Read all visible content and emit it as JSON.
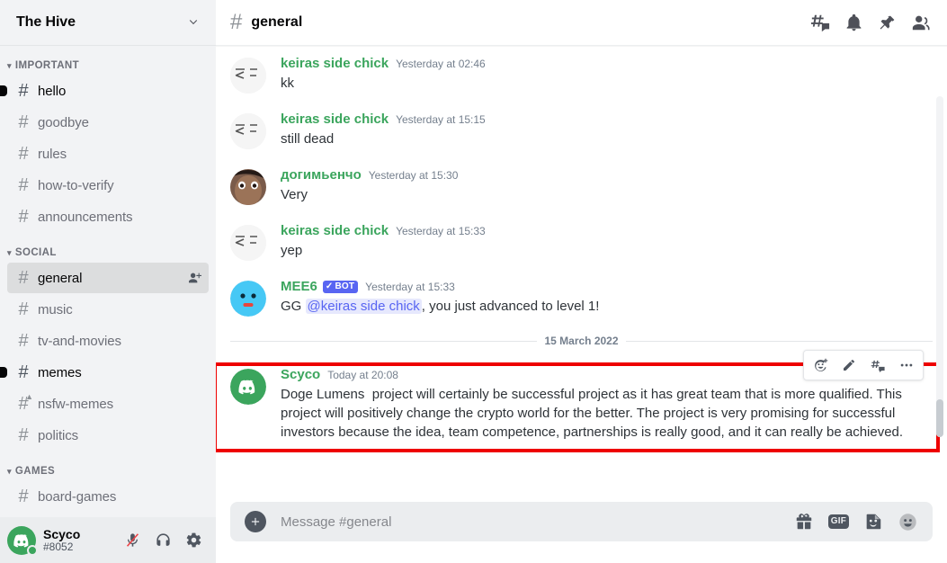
{
  "sidebar": {
    "server_name": "The Hive",
    "categories": [
      {
        "label": "IMPORTANT",
        "channels": [
          {
            "name": "hello",
            "state": "unread",
            "icon": "hash-icon"
          },
          {
            "name": "goodbye",
            "state": "normal",
            "icon": "hash-icon"
          },
          {
            "name": "rules",
            "state": "normal",
            "icon": "hash-icon"
          },
          {
            "name": "how-to-verify",
            "state": "normal",
            "icon": "hash-icon"
          },
          {
            "name": "announcements",
            "state": "normal",
            "icon": "hash-icon"
          }
        ]
      },
      {
        "label": "SOCIAL",
        "channels": [
          {
            "name": "general",
            "state": "active",
            "icon": "hash-icon",
            "action": "add-member-icon"
          },
          {
            "name": "music",
            "state": "normal",
            "icon": "hash-icon"
          },
          {
            "name": "tv-and-movies",
            "state": "normal",
            "icon": "hash-icon"
          },
          {
            "name": "memes",
            "state": "unread",
            "icon": "hash-icon"
          },
          {
            "name": "nsfw-memes",
            "state": "normal",
            "icon": "hash-nsfw-icon"
          },
          {
            "name": "politics",
            "state": "normal",
            "icon": "hash-icon"
          }
        ]
      },
      {
        "label": "GAMES",
        "channels": [
          {
            "name": "board-games",
            "state": "normal",
            "icon": "hash-icon"
          }
        ]
      }
    ],
    "user": {
      "name": "Scyco",
      "tag": "#8052",
      "status": "online",
      "avatar_color": "#3ba55d",
      "controls": [
        {
          "name": "mute-microphone-button",
          "icon": "microphone-muted-icon",
          "state": "muted"
        },
        {
          "name": "deafen-button",
          "icon": "headphones-icon",
          "state": "on"
        },
        {
          "name": "user-settings-button",
          "icon": "gear-icon",
          "state": "on"
        }
      ]
    }
  },
  "header": {
    "channel_icon": "hash-icon",
    "channel_name": "general",
    "icons": [
      {
        "name": "threads-button",
        "icon": "threads-icon"
      },
      {
        "name": "notification-settings-button",
        "icon": "bell-icon"
      },
      {
        "name": "pinned-messages-button",
        "icon": "pin-icon"
      },
      {
        "name": "member-list-button",
        "icon": "members-icon"
      }
    ]
  },
  "messages": [
    {
      "author": "keiras side chick",
      "author_color": "#3ba55d",
      "timestamp": "Yesterday at 02:46",
      "text": "kk",
      "avatar": "sketch-avatar",
      "bot": false
    },
    {
      "author": "keiras side chick",
      "author_color": "#3ba55d",
      "timestamp": "Yesterday at 15:15",
      "text": "still dead",
      "avatar": "sketch-avatar",
      "bot": false
    },
    {
      "author": "догимьенчо",
      "author_color": "#3ba55d",
      "timestamp": "Yesterday at 15:30",
      "text": "Very",
      "avatar": "photo-avatar",
      "bot": false
    },
    {
      "author": "keiras side chick",
      "author_color": "#3ba55d",
      "timestamp": "Yesterday at 15:33",
      "text": "yep",
      "avatar": "sketch-avatar",
      "bot": false
    },
    {
      "author": "MEE6",
      "author_color": "#3ba55d",
      "timestamp": "Yesterday at 15:33",
      "bot": true,
      "bot_badge": "BOT",
      "avatar": "mee6-avatar",
      "text_prefix": "GG ",
      "mention": "@keiras side chick",
      "text_suffix": ", you just advanced to level 1!"
    }
  ],
  "date_divider": "15 March 2022",
  "highlighted_message": {
    "author": "Scyco",
    "author_color": "#3ba55d",
    "timestamp": "Today at 20:08",
    "avatar": "discord-logo-avatar",
    "avatar_color": "#3ba55d",
    "text": "Doge Lumens  project will certainly be successful project as it has great team that is more qualified. This project will positively change the crypto world for the better. The project is very promising for successful investors because the idea, team competence, partnerships is really good, and it can really be achieved.",
    "highlight_color": "#ee0000",
    "toolbar": [
      {
        "name": "add-reaction-button",
        "icon": "add-reaction-icon"
      },
      {
        "name": "edit-message-button",
        "icon": "pencil-icon"
      },
      {
        "name": "create-thread-button",
        "icon": "create-thread-icon"
      },
      {
        "name": "more-options-button",
        "icon": "more-horizontal-icon"
      }
    ]
  },
  "composer": {
    "placeholder": "Message #general",
    "value": "",
    "attach_icon": "plus-circle-icon",
    "icons": [
      {
        "name": "gift-button",
        "icon": "gift-icon",
        "label": ""
      },
      {
        "name": "gif-button",
        "icon": "gif-icon",
        "label": "GIF"
      },
      {
        "name": "sticker-button",
        "icon": "sticker-icon",
        "label": ""
      },
      {
        "name": "emoji-button",
        "icon": "emoji-icon",
        "label": ""
      }
    ]
  }
}
